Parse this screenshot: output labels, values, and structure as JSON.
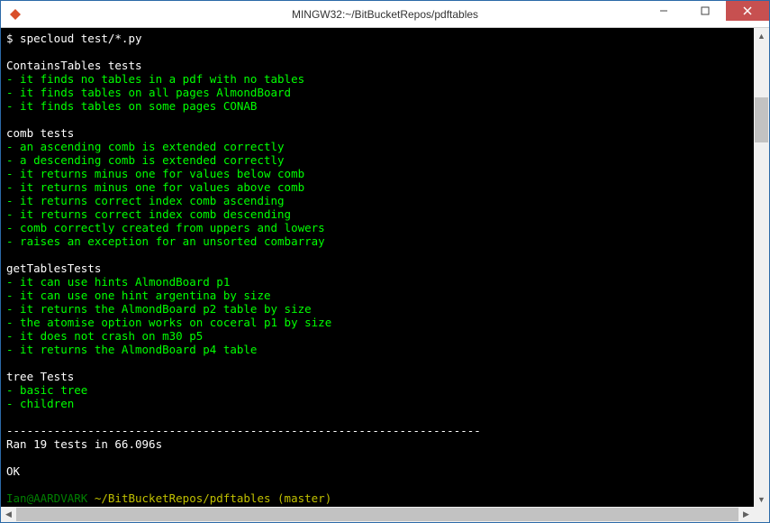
{
  "window": {
    "title": "MINGW32:~/BitBucketRepos/pdftables"
  },
  "terminal": {
    "prompt_line": "$ specloud test/*.py",
    "groups": [
      {
        "header": "ContainsTables tests",
        "items": [
          "- it finds no tables in a pdf with no tables",
          "- it finds tables on all pages AlmondBoard",
          "- it finds tables on some pages CONAB"
        ]
      },
      {
        "header": "comb tests",
        "items": [
          "- an ascending comb is extended correctly",
          "- a descending comb is extended correctly",
          "- it returns minus one for values below comb",
          "- it returns minus one for values above comb",
          "- it returns correct index comb ascending",
          "- it returns correct index comb descending",
          "- comb correctly created from uppers and lowers",
          "- raises an exception for an unsorted combarray"
        ]
      },
      {
        "header": "getTablesTests",
        "items": [
          "- it can use hints AlmondBoard p1",
          "- it can use one hint argentina by size",
          "- it returns the AlmondBoard p2 table by size",
          "- the atomise option works on coceral p1 by size",
          "- it does not crash on m30 p5",
          "- it returns the AlmondBoard p4 table"
        ]
      },
      {
        "header": "tree Tests",
        "items": [
          "- basic tree",
          "- children"
        ]
      }
    ],
    "separator": "----------------------------------------------------------------------",
    "summary_line": "Ran 19 tests in 66.096s",
    "status": "OK",
    "shell_prompt": {
      "user_host": "Ian@AARDVARK",
      "path": " ~/BitBucketRepos/pdftables (master)",
      "symbol": "$"
    }
  }
}
